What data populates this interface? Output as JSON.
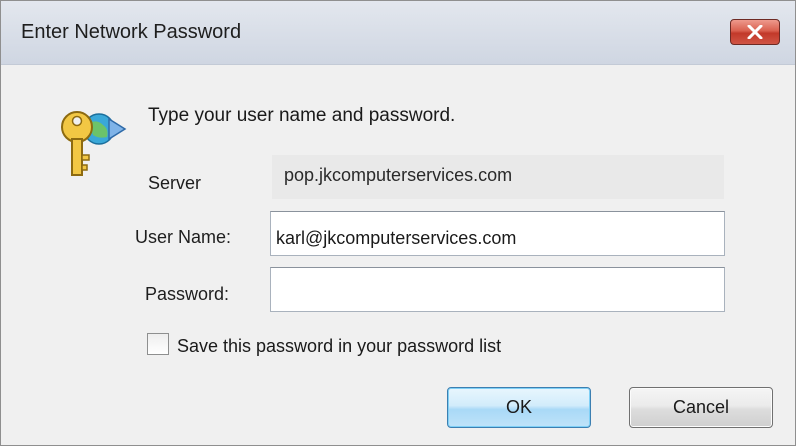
{
  "window": {
    "title": "Enter Network Password",
    "close_icon": "close-icon"
  },
  "dialog": {
    "icon": "key-icon",
    "prompt": "Type your user name and password.",
    "server_label": "Server",
    "server_value": "pop.jkcomputerservices.com",
    "username_label": "User Name:",
    "username_value": "karl@jkcomputerservices.com",
    "password_label": "Password:",
    "password_value": "",
    "save_password_label": "Save this password in your password list",
    "save_password_checked": false
  },
  "buttons": {
    "ok_label": "OK",
    "cancel_label": "Cancel"
  },
  "colors": {
    "close_button": "#c2392a",
    "ok_button_border": "#3c7fb1",
    "dialog_background": "#f0f0f0"
  }
}
